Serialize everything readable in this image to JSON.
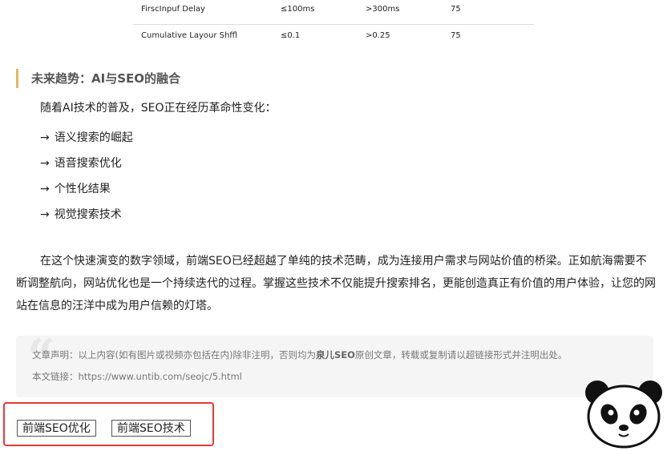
{
  "metrics_table": {
    "rows": [
      {
        "name": "FirscInpuf Delay",
        "good": "≤100ms",
        "poor": ">300ms",
        "weight": "75"
      },
      {
        "name": "Cumulative Layour Shffl",
        "good": "≤0.1",
        "poor": ">0.25",
        "weight": "75"
      }
    ]
  },
  "section": {
    "heading": "未来趋势：AI与SEO的融合",
    "intro": "随着AI技术的普及，SEO正在经历革命性变化：",
    "arrow": "→",
    "items": [
      "语义搜索的崛起",
      "语音搜索优化",
      "个性化结果",
      "视觉搜索技术"
    ]
  },
  "conclusion": "在这个快速演变的数字领域，前端SEO已经超越了单纯的技术范畴，成为连接用户需求与网站价值的桥梁。正如航海需要不断调整航向，网站优化也是一个持续迭代的过程。掌握这些技术不仅能提升搜索排名，更能创造真正有价值的用户体验，让您的网站在信息的汪洋中成为用户信赖的灯塔。",
  "notice": {
    "quote_glyph": "“",
    "line1_prefix": "文章声明：以上内容(如有图片或视频亦包括在内)除非注明，否则均为",
    "line1_brand": "泉儿SEO",
    "line1_suffix": "原创文章，转载或复制请以超链接形式并注明出处。",
    "line2_label": "本文链接：",
    "line2_url": "https://www.untib.com/seojc/5.html"
  },
  "tags": [
    "前端SEO优化",
    "前端SEO技术"
  ],
  "colors": {
    "heading_bar": "#e8b45a",
    "highlight_box": "#e53935",
    "notice_bg": "#f5f5f5"
  },
  "icons": {
    "mascot": "panda-icon"
  }
}
